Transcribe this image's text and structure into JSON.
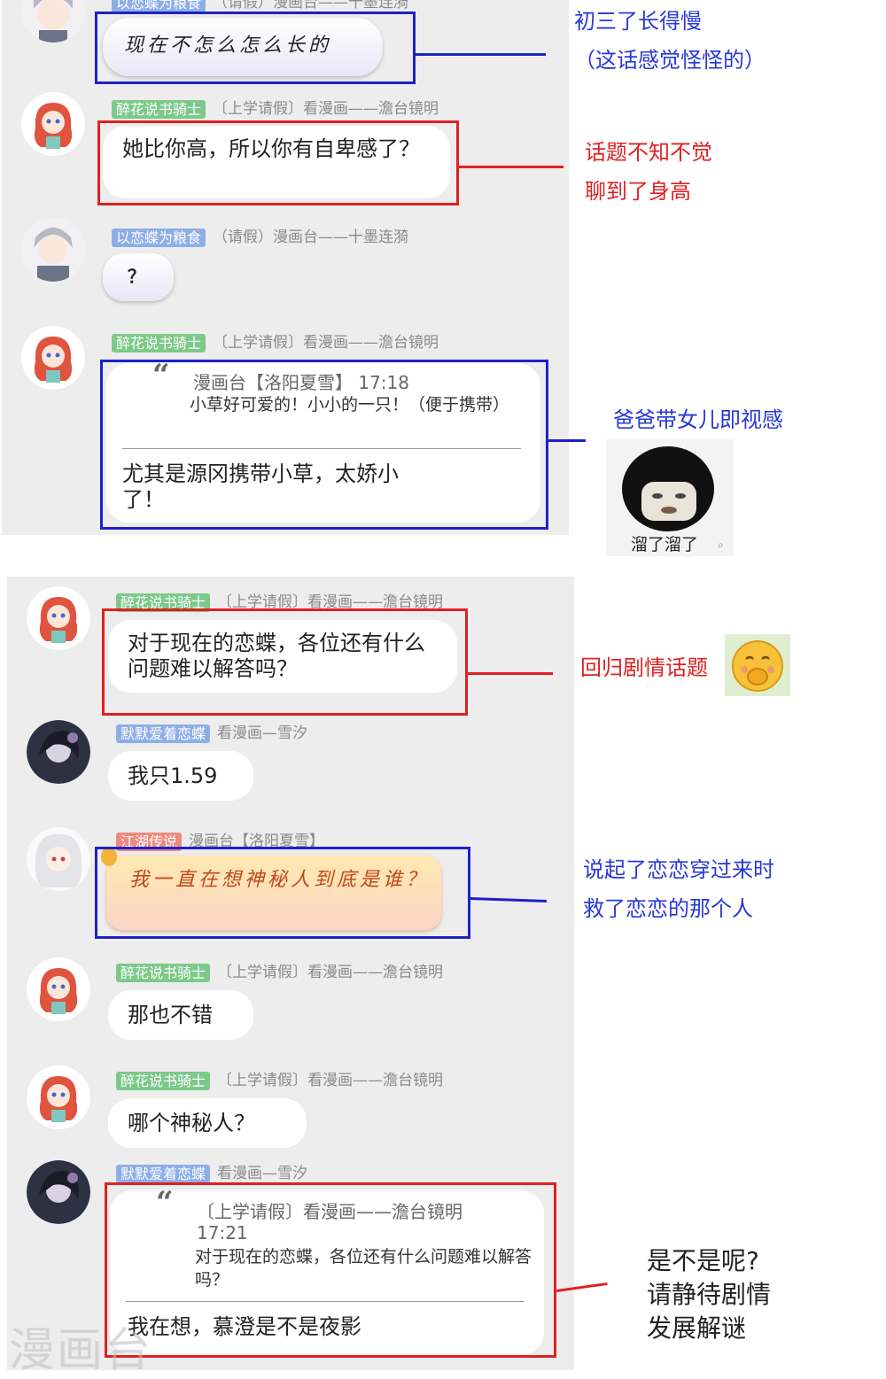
{
  "top_cut": {
    "user": "以恋蝶为粮食",
    "meta": "（请假）漫画台——十墨连漪",
    "message": "现在不怎么怎么长的"
  },
  "chat1": [
    {
      "user": "醉花说书骑士",
      "meta": "〔上学请假〕看漫画——澹台镜明",
      "message": "她比你高，所以你有自卑感了？"
    },
    {
      "user": "以恋蝶为粮食",
      "meta": "（请假）漫画台——十墨连漪",
      "message": "？"
    },
    {
      "user": "醉花说书骑士",
      "meta": "〔上学请假〕看漫画——澹台镜明",
      "quote": {
        "head": "漫画台【洛阳夏雪】 17:18",
        "body": "小草好可爱的！小小的一只！（便于携带）"
      },
      "message": "尤其是源冈携带小草，太娇小了！"
    }
  ],
  "chat2": [
    {
      "user": "醉花说书骑士",
      "meta": "〔上学请假〕看漫画——澹台镜明",
      "message": "对于现在的恋蝶，各位还有什么问题难以解答吗？"
    },
    {
      "user": "默默爱着恋蝶",
      "meta": "看漫画—雪汐",
      "message": "我只1.59"
    },
    {
      "user": "江湖传说",
      "meta": "漫画台【洛阳夏雪】",
      "message": "我一直在想神秘人到底是谁？"
    },
    {
      "user": "醉花说书骑士",
      "meta": "〔上学请假〕看漫画——澹台镜明",
      "message": "那也不错"
    },
    {
      "user": "醉花说书骑士",
      "meta": "〔上学请假〕看漫画——澹台镜明",
      "message": "哪个神秘人？"
    },
    {
      "user": "默默爱着恋蝶",
      "meta": "看漫画—雪汐",
      "quote": {
        "head": "〔上学请假〕看漫画——澹台镜明 17:21",
        "body": "对于现在的恋蝶，各位还有什么问题难以解答吗？"
      },
      "message": "我在想，慕澄是不是夜影"
    }
  ],
  "notes": {
    "n1_line1": "初三了长得慢",
    "n1_line2": "（这话感觉怪怪的）",
    "n2_line1": "话题不知不觉",
    "n2_line2": "聊到了身高",
    "n3": "爸爸带女儿即视感",
    "n3_sticker_caption": "溜了溜了",
    "n4": "回归剧情话题",
    "n5_line1": "说起了恋恋穿过来时",
    "n5_line2": "救了恋恋的那个人",
    "n6_line1": "是不是呢?",
    "n6_line2": "请静待剧情",
    "n6_line3": "发展解谜"
  },
  "watermark": "漫画台",
  "colors": {
    "red": "#e02020",
    "blue": "#2020c8",
    "note_blue": "#2838d8",
    "panel_bg": "#ededed"
  }
}
